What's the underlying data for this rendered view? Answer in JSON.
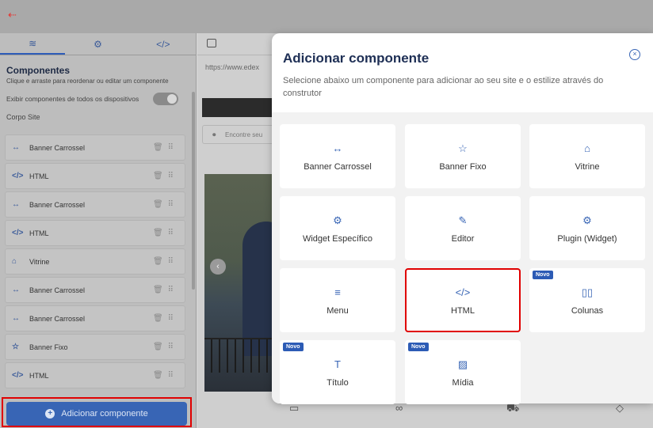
{
  "topbar": {
    "exit_icon": "exit-icon"
  },
  "sidebar": {
    "tabs": [
      {
        "icon": "layers-icon",
        "glyph": "≋"
      },
      {
        "icon": "settings-icon",
        "glyph": "⚙"
      },
      {
        "icon": "code-icon",
        "glyph": "</>"
      }
    ],
    "title": "Componentes",
    "subtitle": "Clique e arraste para reordenar ou editar um componente",
    "toggle_label": "Exibir componentes de todos os dispositivos",
    "section_label": "Corpo Site",
    "items": [
      {
        "icon": "↔",
        "label": "Banner Carrossel"
      },
      {
        "icon": "</>",
        "label": "HTML"
      },
      {
        "icon": "↔",
        "label": "Banner Carrossel"
      },
      {
        "icon": "</>",
        "label": "HTML"
      },
      {
        "icon": "⌂",
        "label": "Vitrine"
      },
      {
        "icon": "↔",
        "label": "Banner Carrossel"
      },
      {
        "icon": "↔",
        "label": "Banner Carrossel"
      },
      {
        "icon": "☆",
        "label": "Banner Fixo"
      },
      {
        "icon": "</>",
        "label": "HTML"
      }
    ],
    "add_button_label": "Adicionar componente"
  },
  "preview": {
    "url": "https://www.edex",
    "search_placeholder": "Encontre seu"
  },
  "modal": {
    "title": "Adicionar componente",
    "subtitle": "Selecione abaixo um componente para adicionar ao seu site e o estilize através do construtor",
    "cards": [
      {
        "icon": "↔",
        "label": "Banner Carrossel",
        "badge": ""
      },
      {
        "icon": "☆",
        "label": "Banner Fixo",
        "badge": ""
      },
      {
        "icon": "⌂",
        "label": "Vitrine",
        "badge": ""
      },
      {
        "icon": "⚙",
        "label": "Widget Específico",
        "badge": ""
      },
      {
        "icon": "✎",
        "label": "Editor",
        "badge": ""
      },
      {
        "icon": "⚙",
        "label": "Plugin (Widget)",
        "badge": ""
      },
      {
        "icon": "≡",
        "label": "Menu",
        "badge": ""
      },
      {
        "icon": "</>",
        "label": "HTML",
        "badge": ""
      },
      {
        "icon": "▯▯",
        "label": "Colunas",
        "badge": "Novo"
      },
      {
        "icon": "T",
        "label": "Título",
        "badge": "Novo"
      },
      {
        "icon": "▨",
        "label": "Mídia",
        "badge": "Novo"
      }
    ]
  },
  "colors": {
    "accent": "#3865b5",
    "highlight": "#e00000"
  }
}
